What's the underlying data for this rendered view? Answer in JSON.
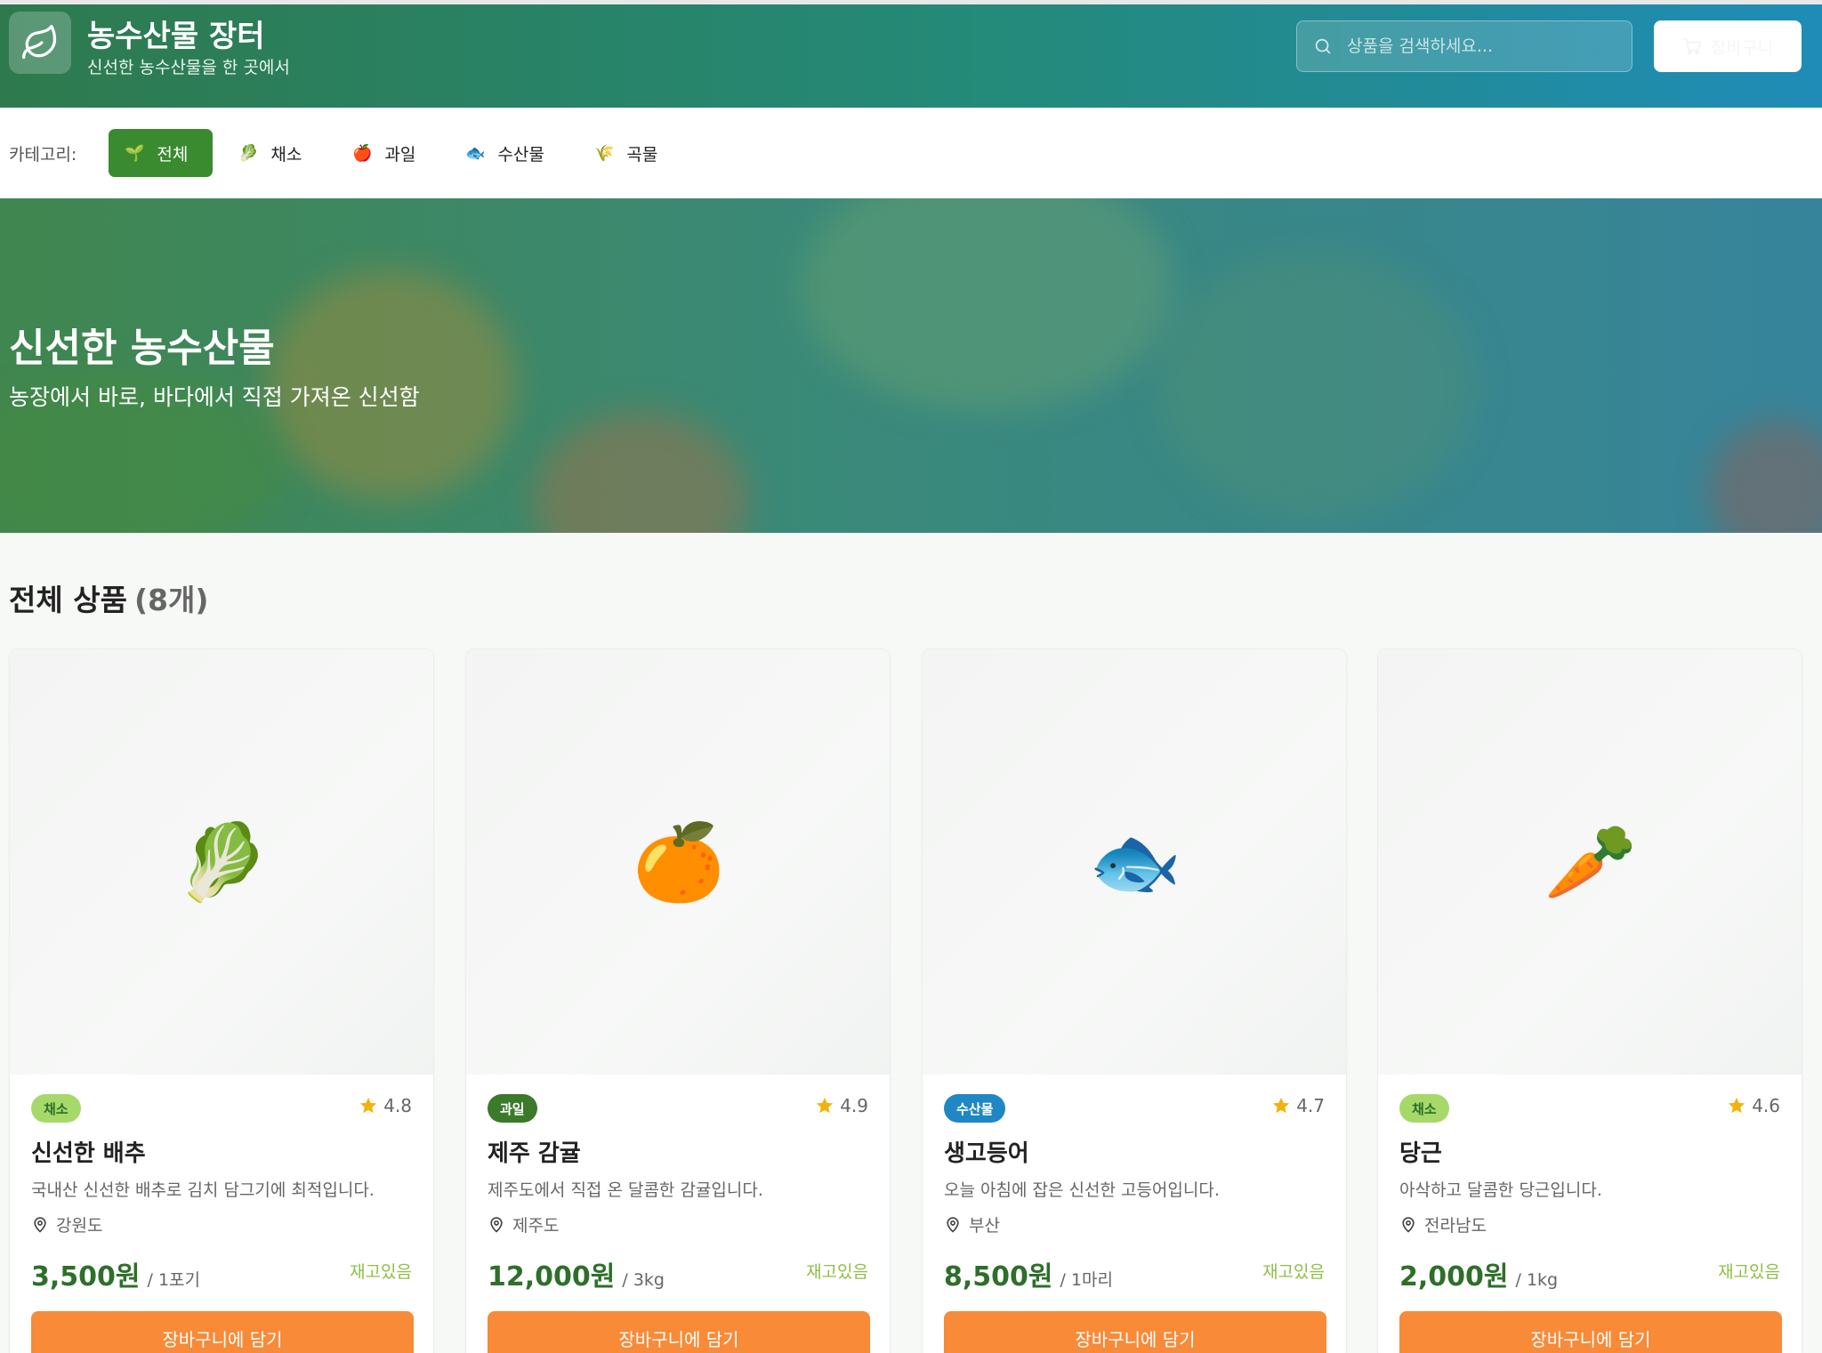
{
  "header": {
    "title": "농수산물 장터",
    "subtitle": "신선한 농수산물을 한 곳에서",
    "search_placeholder": "상품을 검색하세요...",
    "cart_label": "장바구니"
  },
  "categories": {
    "label": "카테고리:",
    "items": [
      {
        "emoji": "🌱",
        "label": "전체",
        "active": true
      },
      {
        "emoji": "🥬",
        "label": "채소",
        "active": false
      },
      {
        "emoji": "🍎",
        "label": "과일",
        "active": false
      },
      {
        "emoji": "🐟",
        "label": "수산물",
        "active": false
      },
      {
        "emoji": "🌾",
        "label": "곡물",
        "active": false
      }
    ]
  },
  "hero": {
    "title": "신선한 농수산물",
    "subtitle": "농장에서 바로, 바다에서 직접 가져온 신선함"
  },
  "section": {
    "title": "전체 상품",
    "count": "(8개)"
  },
  "products": [
    {
      "emoji": "🥬",
      "category": "채소",
      "rating": "4.8",
      "name": "신선한 배추",
      "description": "국내산 신선한 배추로 김치 담그기에 최적입니다.",
      "origin": "강원도",
      "price": "3,500원",
      "unit": "/ 1포기",
      "stock": "재고있음",
      "button": "장바구니에 담기"
    },
    {
      "emoji": "🍊",
      "category": "과일",
      "rating": "4.9",
      "name": "제주 감귤",
      "description": "제주도에서 직접 온 달콤한 감귤입니다.",
      "origin": "제주도",
      "price": "12,000원",
      "unit": "/ 3kg",
      "stock": "재고있음",
      "button": "장바구니에 담기"
    },
    {
      "emoji": "🐟",
      "category": "수산물",
      "rating": "4.7",
      "name": "생고등어",
      "description": "오늘 아침에 잡은 신선한 고등어입니다.",
      "origin": "부산",
      "price": "8,500원",
      "unit": "/ 1마리",
      "stock": "재고있음",
      "button": "장바구니에 담기"
    },
    {
      "emoji": "🥕",
      "category": "채소",
      "rating": "4.6",
      "name": "당근",
      "description": "아삭하고 달콤한 당근입니다.",
      "origin": "전라남도",
      "price": "2,000원",
      "unit": "/ 1kg",
      "stock": "재고있음",
      "button": "장바구니에 담기"
    }
  ],
  "colors": {
    "vegetable_badge_bg": "#a6d96a",
    "vegetable_badge_text": "#2e6f2a",
    "fruit_badge_bg": "#3a7a2a",
    "seafood_badge_bg": "#1e87c4",
    "price": "#2e6f2a",
    "add_button": "#f88a38",
    "active_tab": "#3a8a2f",
    "stock": "#8fbf45"
  }
}
